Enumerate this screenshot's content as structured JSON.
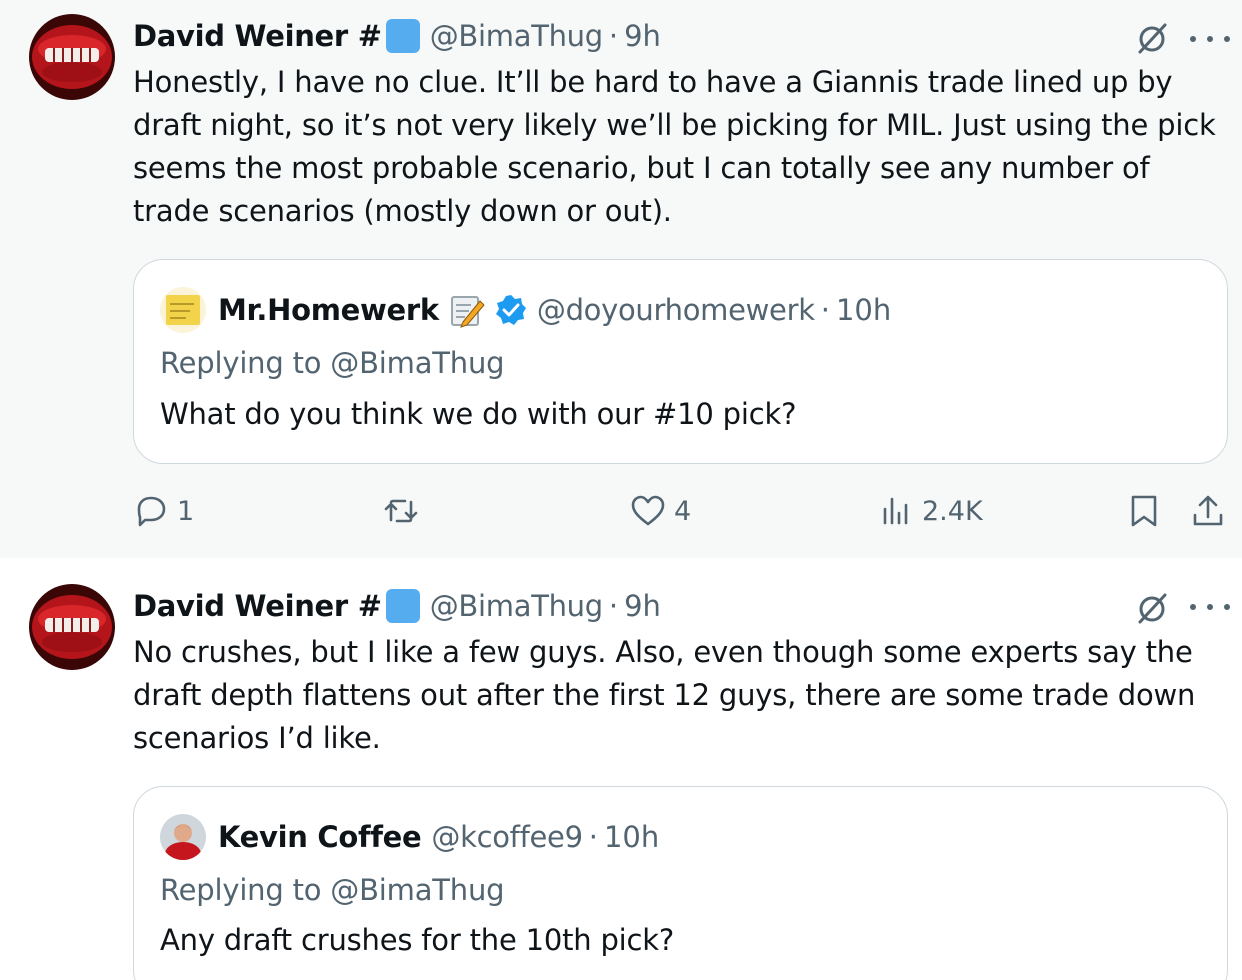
{
  "tweets": [
    {
      "author": {
        "name": "David Weiner #",
        "handle": "@BimaThug",
        "time": "9h",
        "avatar_icon": "red-lips-avatar"
      },
      "text_lines": [
        "Honestly, I have no clue. It’ll be hard to have a Giannis trade lined up by",
        "draft night, so it’s not very likely we’ll be picking for MIL. Just using the pick",
        "seems the most probable scenario, but I can totally see any number of",
        "trade scenarios (mostly down or out)."
      ],
      "quote": {
        "name": "Mr.Homewerk",
        "handle": "@doyourhomewerk",
        "time": "10h",
        "replying": "Replying to @BimaThug",
        "text": "What do you think we do with our #10 pick?"
      },
      "actions": {
        "replies": "1",
        "likes": "4",
        "views": "2.4K"
      }
    },
    {
      "author": {
        "name": "David Weiner #",
        "handle": "@BimaThug",
        "time": "9h",
        "avatar_icon": "red-lips-avatar"
      },
      "text_lines": [
        "No crushes, but I like a few guys. Also, even though some experts say the",
        "draft depth flattens out after the first 12 guys, there are some trade down",
        "scenarios I’d like."
      ],
      "quote": {
        "name": "Kevin Coffee",
        "handle": "@kcoffee9",
        "time": "10h",
        "replying": "Replying to @BimaThug",
        "text": "Any draft crushes for the 10th pick?"
      }
    }
  ],
  "separator": "·",
  "colors": {
    "secondary_text": "#536471",
    "border": "#cfd9de",
    "verified": "#1d9bf0",
    "flag_badge": "#55acee",
    "thread_bg": "#f7f9f9"
  }
}
